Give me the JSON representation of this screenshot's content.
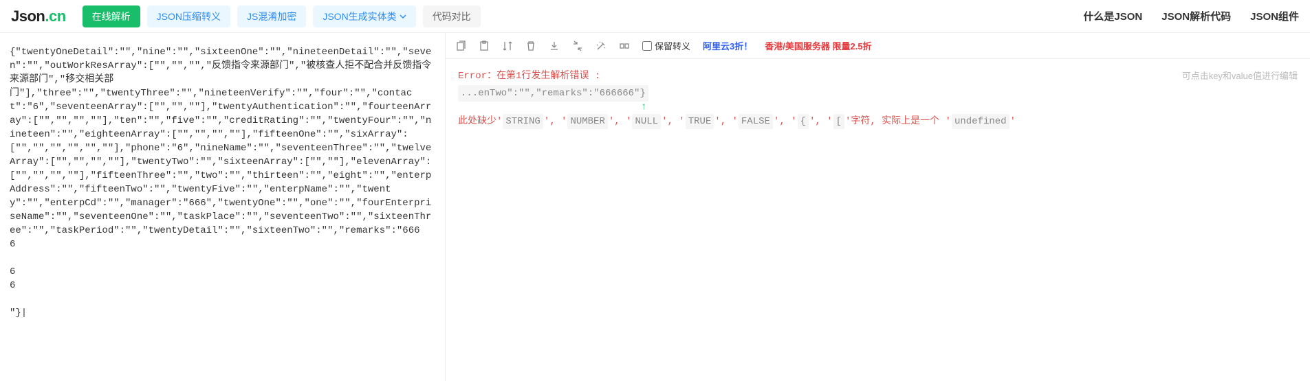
{
  "logo": {
    "part1": "Json",
    "part2": ".cn"
  },
  "nav": {
    "parse": "在线解析",
    "compress": "JSON压缩转义",
    "obfuscate": "JS混淆加密",
    "entity": "JSON生成实体类",
    "diff": "代码对比"
  },
  "navRight": {
    "what": "什么是JSON",
    "code": "JSON解析代码",
    "component": "JSON组件"
  },
  "input": "{\"twentyOneDetail\":\"\",\"nine\":\"\",\"sixteenOne\":\"\",\"nineteenDetail\":\"\",\"seven\":\"\",\"outWorkResArray\":[\"\",\"\",\"\",\"反馈指令来源部门\",\"被核查人拒不配合并反馈指令来源部门\",\"移交相关部\n门\"],\"three\":\"\",\"twentyThree\":\"\",\"nineteenVerify\":\"\",\"four\":\"\",\"contact\":\"6\",\"seventeenArray\":[\"\",\"\",\"\"],\"twentyAuthentication\":\"\",\"fourteenArray\":[\"\",\"\",\"\",\"\"],\"ten\":\"\",\"five\":\"\",\"creditRating\":\"\",\"twentyFour\":\"\",\"nineteen\":\"\",\"eighteenArray\":[\"\",\"\",\"\",\"\"],\"fifteenOne\":\"\",\"sixArray\":[\"\",\"\",\"\",\"\",\"\",\"\"],\"phone\":\"6\",\"nineName\":\"\",\"seventeenThree\":\"\",\"twelveArray\":[\"\",\"\",\"\",\"\"],\"twentyTwo\":\"\",\"sixteenArray\":[\"\",\"\"],\"elevenArray\":[\"\",\"\",\"\",\"\"],\"fifteenThree\":\"\",\"two\":\"\",\"thirteen\":\"\",\"eight\":\"\",\"enterpAddress\":\"\",\"fifteenTwo\":\"\",\"twentyFive\":\"\",\"enterpName\":\"\",\"twenty\":\"\",\"enterpCd\":\"\",\"manager\":\"666\",\"twentyOne\":\"\",\"one\":\"\",\"fourEnterpriseName\":\"\",\"seventeenOne\":\"\",\"taskPlace\":\"\",\"seventeenTwo\":\"\",\"sixteenThree\":\"\",\"taskPeriod\":\"\",\"twentyDetail\":\"\",\"sixteenTwo\":\"\",\"remarks\":\"666\n6\n\n6\n6\n\n\"}|",
  "toolbar": {
    "keepEscape": "保留转义",
    "promo1": "阿里云3折！",
    "promo2": "香港/美国服务器 限量2.5折"
  },
  "output": {
    "hint": "可点击key和value值进行编辑",
    "errorPrefix": "Error：",
    "errorLine": "在第1行发生解析错误 :",
    "snippet": "...enTwo\":\"\",\"remarks\":\"666666\"}",
    "msg1": "此处缺少'",
    "tokens": [
      "STRING",
      "NUMBER",
      "NULL",
      "TRUE",
      "FALSE",
      "{",
      "["
    ],
    "msg2": "'字符, 实际上是一个 '",
    "undef": "undefined",
    "msg3": "'"
  }
}
